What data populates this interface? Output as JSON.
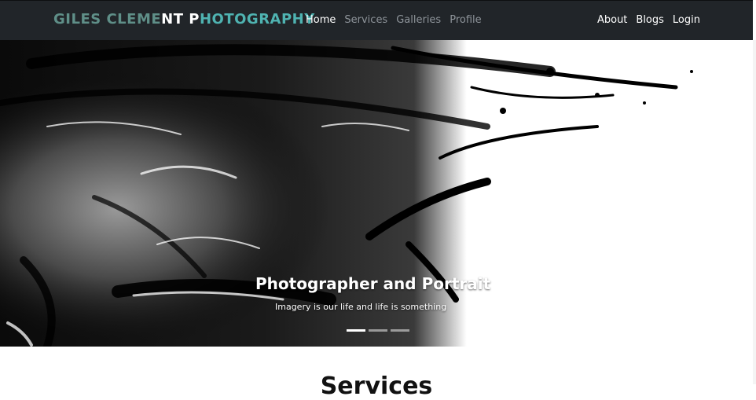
{
  "navbar": {
    "brand_part1": "GILES CLEME",
    "brand_part2": "NT P",
    "brand_part3": "HOTOGRAPHY",
    "left_links": [
      "Home",
      "Services",
      "Galleries",
      "Profile"
    ],
    "right_links": [
      "About",
      "Blogs",
      "Login"
    ],
    "active": "Home"
  },
  "hero": {
    "title": "Photographer and Portrait",
    "subtitle": "Imagery is our life and life is something",
    "slides": 3,
    "active_slide": 0
  },
  "section": {
    "heading": "Services"
  },
  "colors": {
    "navbar_bg": "#212529",
    "brand_teal": "#4fb3b1",
    "brand_muted": "#5f8f88"
  }
}
